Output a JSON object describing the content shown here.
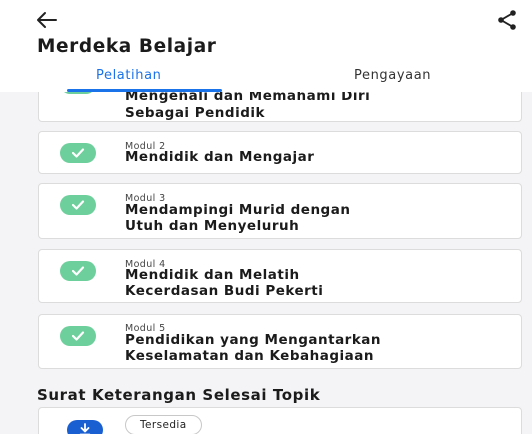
{
  "header": {
    "back_icon": "arrow-left-icon",
    "share_icon": "share-icon",
    "title": "Merdeka Belajar"
  },
  "tabs": [
    {
      "label": "Pelatihan",
      "active": true
    },
    {
      "label": "Pengayaan",
      "active": false
    }
  ],
  "modules": [
    {
      "label": "",
      "title_lines": [
        "Mengenali dan Memahami Diri",
        "Sebagai Pendidik"
      ],
      "completed": true
    },
    {
      "label": "Modul 2",
      "title_lines": [
        "Mendidik dan Mengajar"
      ],
      "completed": true
    },
    {
      "label": "Modul 3",
      "title_lines": [
        "Mendampingi Murid dengan",
        "Utuh dan Menyeluruh"
      ],
      "completed": true
    },
    {
      "label": "Modul 4",
      "title_lines": [
        "Mendidik dan Melatih",
        "Kecerdasan Budi Pekerti"
      ],
      "completed": true
    },
    {
      "label": "Modul 5",
      "title_lines": [
        "Pendidikan yang Mengantarkan",
        "Keselamatan dan Kebahagiaan"
      ],
      "completed": true
    }
  ],
  "certificate": {
    "section_title": "Surat Keterangan Selesai Topik",
    "status": "Tersedia",
    "download_icon": "download-icon"
  },
  "colors": {
    "accent": "#1a73e8",
    "check_badge": "#6dcf9b",
    "download_badge": "#1a5fd1",
    "content_bg": "#f4f4f6"
  }
}
